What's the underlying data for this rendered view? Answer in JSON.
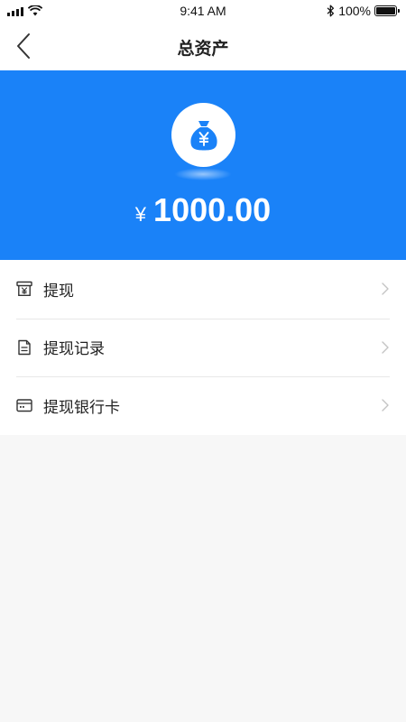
{
  "status_bar": {
    "time": "9:41 AM",
    "battery": "100%",
    "icons": [
      "signal-icon",
      "wifi-icon",
      "bluetooth-icon",
      "battery-icon"
    ]
  },
  "nav": {
    "title": "总资产",
    "back_icon": "back-chevron-icon"
  },
  "balance": {
    "currency_symbol": "¥",
    "amount": "1000.00",
    "icon": "money-bag-icon"
  },
  "menu": {
    "items": [
      {
        "label": "提现",
        "icon": "withdraw-icon"
      },
      {
        "label": "提现记录",
        "icon": "document-icon"
      },
      {
        "label": "提现银行卡",
        "icon": "bank-card-icon"
      }
    ]
  },
  "colors": {
    "accent": "#1a82f8",
    "background": "#f7f7f7",
    "surface": "#ffffff",
    "text": "#222222",
    "divider": "#e8e8e8",
    "chevron": "#c4c4c4"
  }
}
